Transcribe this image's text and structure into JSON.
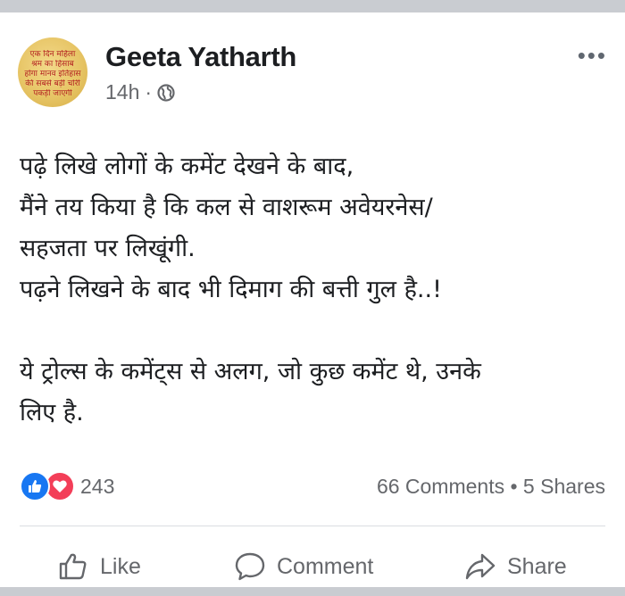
{
  "post": {
    "author": "Geeta Yatharth",
    "time": "14h",
    "separator": "·",
    "more_label": "•••",
    "avatar_text": [
      "एक दिन महिला",
      "श्रम का हिसाब",
      "होगा मानव इतिहास",
      "की सबसे बड़ी चोरी",
      "पकड़ी जाएगी"
    ],
    "text_lines": [
      "पढ़े लिखे लोगों के कमेंट देखने के बाद,",
      "मैंने तय किया है कि कल से वाशरूम अवेयरनेस/",
      "सहजता पर लिखूंगी.",
      "पढ़ने लिखने के बाद भी दिमाग की बत्ती गुल है..!",
      "",
      "ये ट्रोल्स के कमेंट्स से अलग, जो कुछ कमेंट थे, उनके",
      "लिए है."
    ]
  },
  "stats": {
    "reactions_count": "243",
    "comments_shares": "66 Comments • 5 Shares"
  },
  "actions": {
    "like": "Like",
    "comment": "Comment",
    "share": "Share"
  },
  "colors": {
    "like_blue": "#1877f2",
    "love_red": "#f33e58",
    "text": "#1c1e21",
    "secondary": "#65676b"
  }
}
